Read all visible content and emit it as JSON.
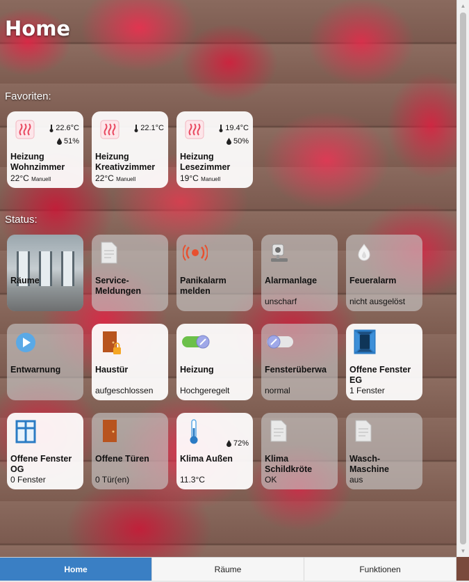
{
  "header": {
    "title": "Home"
  },
  "favorites": {
    "label": "Favoriten:",
    "items": [
      {
        "name_line1": "Heizung",
        "name_line2": "Wohnzimmer",
        "temp": "22.6°C",
        "humidity": "51%",
        "setpoint": "22°C",
        "mode": "Manuell"
      },
      {
        "name_line1": "Heizung",
        "name_line2": "Kreativzimmer",
        "temp": "22.1°C",
        "humidity": "",
        "setpoint": "22°C",
        "mode": "Manuell"
      },
      {
        "name_line1": "Heizung",
        "name_line2": "Lesezimmer",
        "temp": "19.4°C",
        "humidity": "50%",
        "setpoint": "19°C",
        "mode": "Manuell"
      }
    ]
  },
  "status": {
    "label": "Status:",
    "row1": [
      {
        "name_line1": "Räume",
        "name_line2": "",
        "value": ""
      },
      {
        "name_line1": "Service-",
        "name_line2": "Meldungen",
        "value": ""
      },
      {
        "name_line1": "Panikalarm",
        "name_line2": "melden",
        "value": ""
      },
      {
        "name_line1": "Alarmanlage",
        "name_line2": "",
        "value": "unscharf"
      },
      {
        "name_line1": "Feueralarm",
        "name_line2": "",
        "value": "nicht ausgelöst"
      }
    ],
    "row2": [
      {
        "name_line1": "Entwarnung",
        "name_line2": "",
        "value": ""
      },
      {
        "name_line1": "Haustür",
        "name_line2": "",
        "value": "aufgeschlossen"
      },
      {
        "name_line1": "Heizung",
        "name_line2": "",
        "value": "Hochgeregelt"
      },
      {
        "name_line1": "Fensterüberwa",
        "name_line2": "",
        "value": "normal"
      },
      {
        "name_line1": "Offene Fenster",
        "name_line2": "EG",
        "value": "1 Fenster"
      }
    ],
    "row3": [
      {
        "name_line1": "Offene Fenster",
        "name_line2": "OG",
        "value": "0 Fenster"
      },
      {
        "name_line1": "Offene Türen",
        "name_line2": "",
        "value": "0 Tür(en)"
      },
      {
        "name_line1": "Klima Außen",
        "name_line2": "",
        "value": "11.3°C",
        "humidity": "72%"
      },
      {
        "name_line1": "Klima",
        "name_line2": "Schildkröte",
        "value": "OK"
      },
      {
        "name_line1": "Wasch-",
        "name_line2": "Maschine",
        "value": "aus"
      }
    ]
  },
  "tabs": [
    {
      "label": "Home",
      "active": true
    },
    {
      "label": "Räume",
      "active": false
    },
    {
      "label": "Funktionen",
      "active": false
    }
  ],
  "colors": {
    "accent": "#3a7fc4",
    "heating_icon": "#e8475f",
    "door": "#b8541e",
    "window_frame": "#2b7bc4",
    "toggle_on": "#6cc04a"
  },
  "icons": {
    "heating": "heating-icon",
    "thermometer": "thermometer-icon",
    "drop": "drop-icon",
    "document": "document-icon",
    "panic": "panic-alarm-icon",
    "alarm": "alarm-sensor-icon",
    "fire": "fire-icon",
    "play": "play-icon",
    "door": "door-icon",
    "toggle": "toggle-icon",
    "window": "window-icon"
  }
}
